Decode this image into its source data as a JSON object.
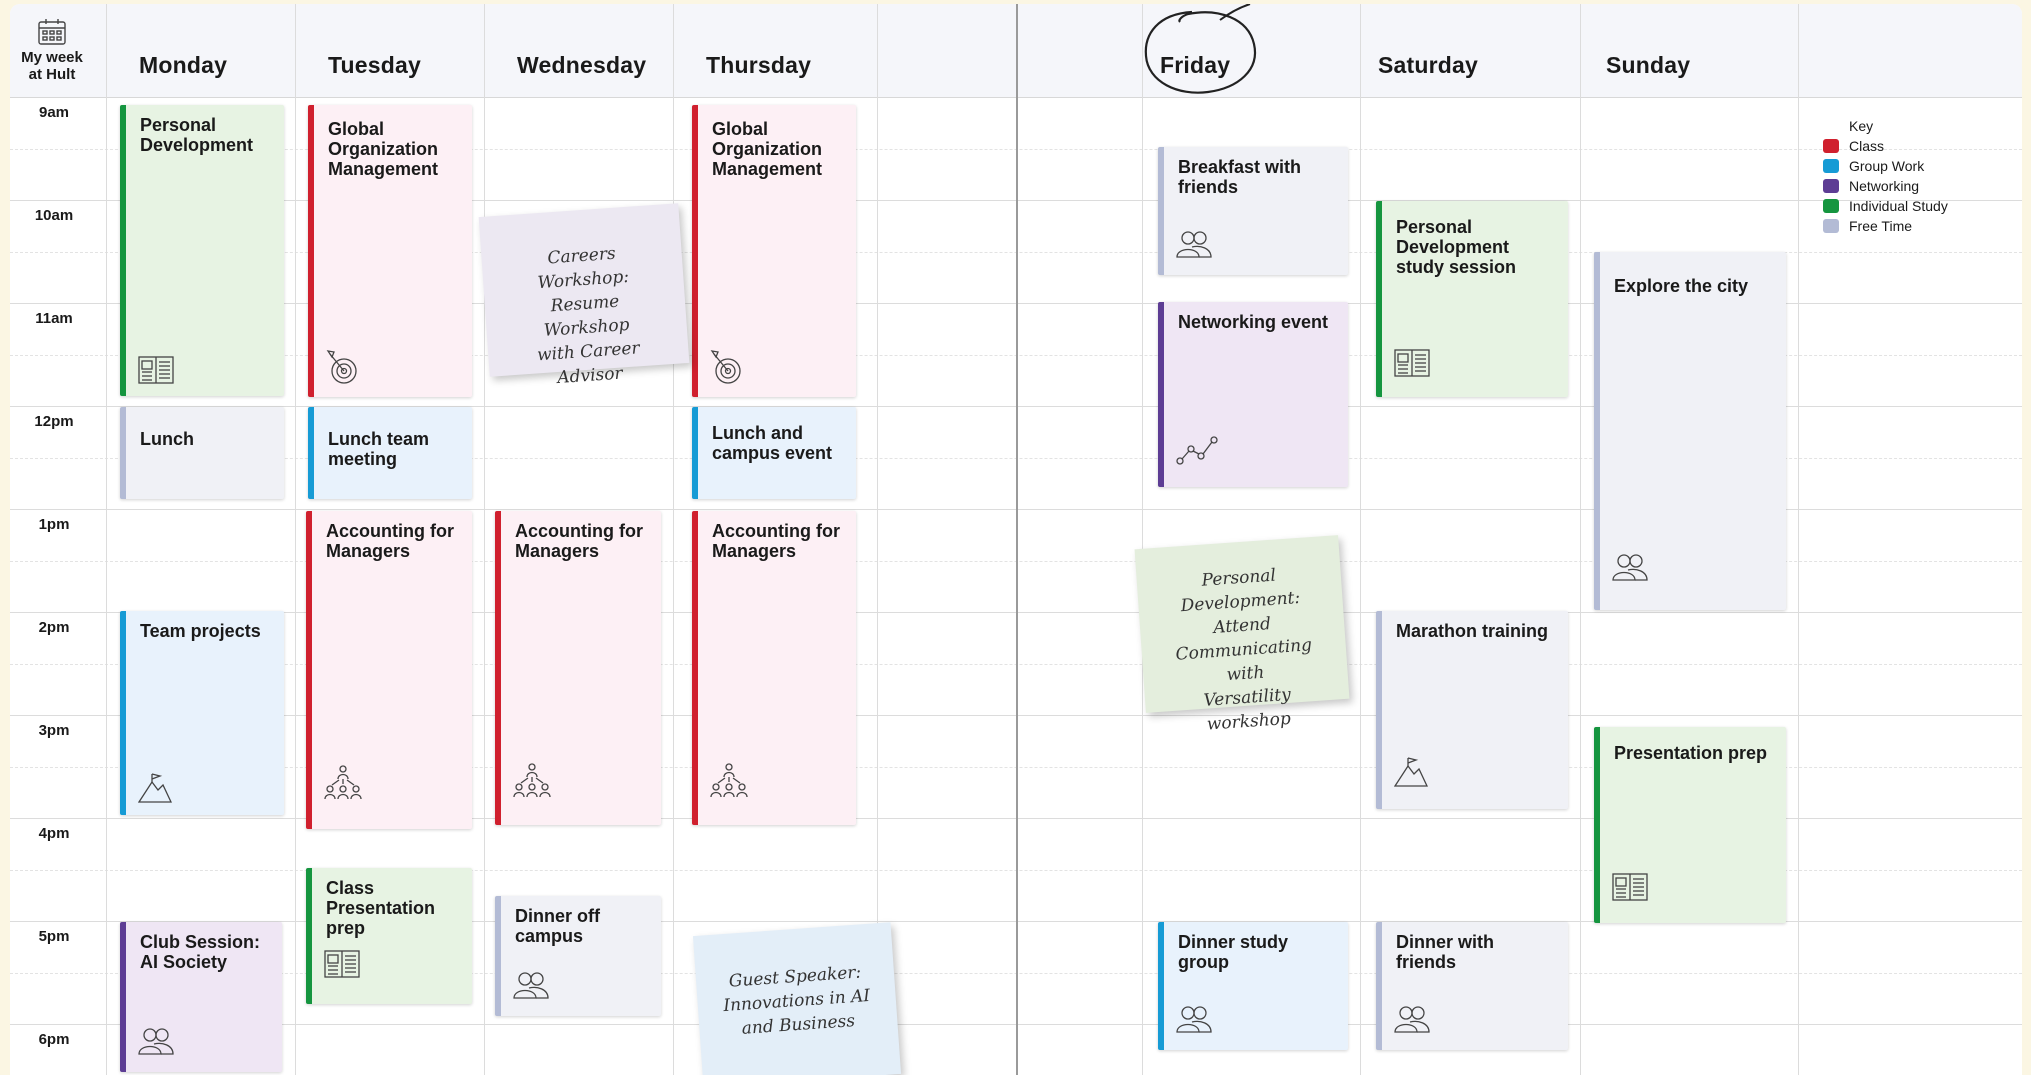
{
  "corner": {
    "title": "My week\nat Hult"
  },
  "days": [
    "Monday",
    "Tuesday",
    "Wednesday",
    "Thursday",
    "Friday",
    "Saturday",
    "Sunday"
  ],
  "times": [
    "9am",
    "10am",
    "11am",
    "12pm",
    "1pm",
    "2pm",
    "3pm",
    "4pm",
    "5pm",
    "6pm"
  ],
  "events": {
    "mon_personal_dev": "Personal Development",
    "mon_lunch": "Lunch",
    "mon_team_projects": "Team projects",
    "mon_club_session": "Club Session: AI Society",
    "tue_global_org": "Global Organization Management",
    "tue_lunch_team": "Lunch team meeting",
    "tue_accounting": "Accounting for Managers",
    "tue_class_prep": "Class Presentation prep",
    "wed_accounting": "Accounting for Managers",
    "wed_dinner": "Dinner off campus",
    "thu_global_org": "Global Organization Management",
    "thu_lunch_campus": "Lunch and campus event",
    "thu_accounting": "Accounting for Managers",
    "fri_breakfast": "Breakfast with friends",
    "fri_networking": "Networking event",
    "fri_dinner_study": "Dinner study group",
    "sat_personal_dev": "Personal Development study session",
    "sat_marathon": "Marathon training",
    "sat_dinner_friends": "Dinner with friends",
    "sun_explore": "Explore the city",
    "sun_presentation": "Presentation prep"
  },
  "notes": {
    "careers": [
      "Careers Workshop:",
      "Resume Workshop",
      "with Career Advisor"
    ],
    "personal_dev": [
      "Personal Development:",
      "Attend",
      "Communicating with",
      "Versatility workshop"
    ],
    "guest": [
      "Guest Speaker:",
      "Innovations in AI",
      "and Business"
    ]
  },
  "key": {
    "title": "Key",
    "items": [
      {
        "label": "Class",
        "color": "#d0202e"
      },
      {
        "label": "Group Work",
        "color": "#169bd5"
      },
      {
        "label": "Networking",
        "color": "#5d3d94"
      },
      {
        "label": "Individual Study",
        "color": "#15953f"
      },
      {
        "label": "Free Time",
        "color": "#b3bbd5"
      }
    ]
  },
  "icons": [
    "calendar-icon",
    "book-icon",
    "target-icon",
    "people-icon",
    "mountain-flag-icon",
    "team-hierarchy-icon",
    "network-chart-icon"
  ]
}
